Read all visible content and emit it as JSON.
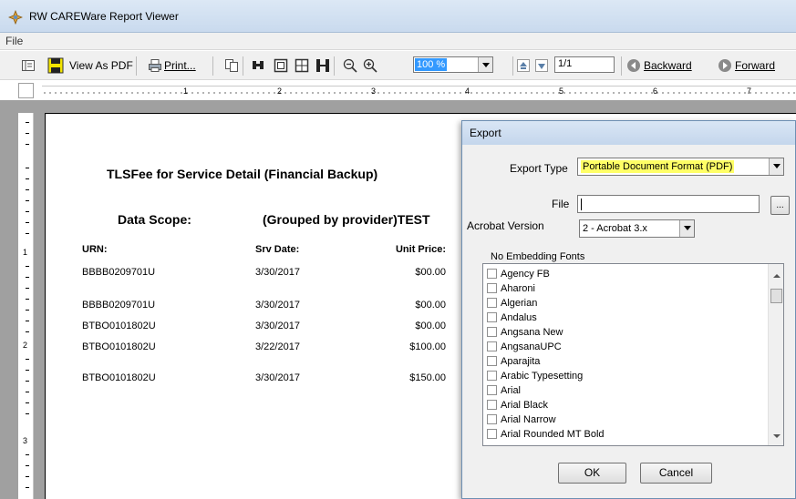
{
  "window": {
    "title": "RW CAREWare Report Viewer"
  },
  "menu": {
    "file": "File"
  },
  "toolbar": {
    "view_as_pdf": "View As PDF",
    "print": "Print...",
    "zoom": "100 %",
    "page": "1/1",
    "backward": "Backward",
    "forward": "Forward"
  },
  "ruler": {
    "h_numbers": [
      "1",
      "2",
      "3",
      "4",
      "5",
      "6",
      "7"
    ],
    "v_numbers": [
      "1",
      "2",
      "3"
    ]
  },
  "report": {
    "title": "TLSFee for Service Detail (Financial Backup)",
    "scope_label": "Data Scope:",
    "scope_value": "(Grouped by provider)TEST",
    "columns": [
      "URN:",
      "Srv Date:",
      "Unit Price:"
    ],
    "rows": [
      [
        "BBBB0209701U",
        "3/30/2017",
        "$00.00"
      ],
      [
        "BBBB0209701U",
        "3/30/2017",
        "$00.00"
      ],
      [
        "BTBO0101802U",
        "3/30/2017",
        "$00.00"
      ],
      [
        "BTBO0101802U",
        "3/22/2017",
        "$100.00"
      ],
      [
        "BTBO0101802U",
        "3/30/2017",
        "$150.00"
      ]
    ]
  },
  "export_dialog": {
    "title": "Export",
    "export_type_label": "Export Type",
    "export_type_value": "Portable Document Format (PDF)",
    "file_label": "File",
    "file_value": "",
    "browse_label": "...",
    "acrobat_label": "Acrobat Version",
    "acrobat_value": "2 - Acrobat 3.x",
    "fonts_label": "No Embedding Fonts",
    "fonts": [
      "Agency FB",
      "Aharoni",
      "Algerian",
      "Andalus",
      "Angsana New",
      "AngsanaUPC",
      "Aparajita",
      "Arabic Typesetting",
      "Arial",
      "Arial Black",
      "Arial Narrow",
      "Arial Rounded MT Bold"
    ],
    "ok": "OK",
    "cancel": "Cancel"
  },
  "colors": {
    "highlight": "#ffff66",
    "selection": "#3399ff",
    "workspace": "#a0a0a0"
  }
}
